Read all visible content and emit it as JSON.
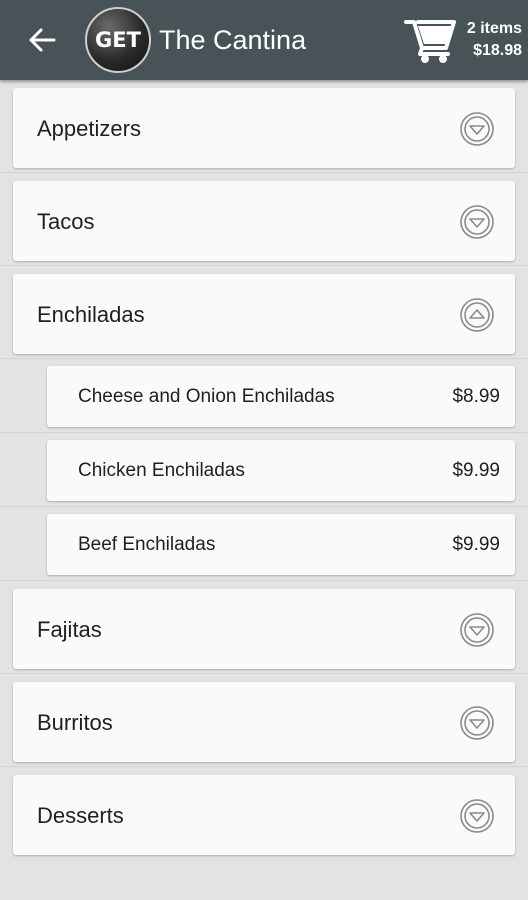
{
  "header": {
    "logo_text": "GET",
    "title": "The Cantina",
    "cart_count": "2 items",
    "cart_total": "$18.98"
  },
  "colors": {
    "appbar": "#475357",
    "background": "#e3e3e3",
    "card": "#fafafa"
  },
  "categories": [
    {
      "label": "Appetizers",
      "expanded": false
    },
    {
      "label": "Tacos",
      "expanded": false
    },
    {
      "label": "Enchiladas",
      "expanded": true
    },
    {
      "label": "Fajitas",
      "expanded": false
    },
    {
      "label": "Burritos",
      "expanded": false
    },
    {
      "label": "Desserts",
      "expanded": false
    }
  ],
  "enchiladas_items": [
    {
      "name": "Cheese and Onion Enchiladas",
      "price": "$8.99"
    },
    {
      "name": "Chicken Enchiladas",
      "price": "$9.99"
    },
    {
      "name": "Beef Enchiladas",
      "price": "$9.99"
    }
  ]
}
